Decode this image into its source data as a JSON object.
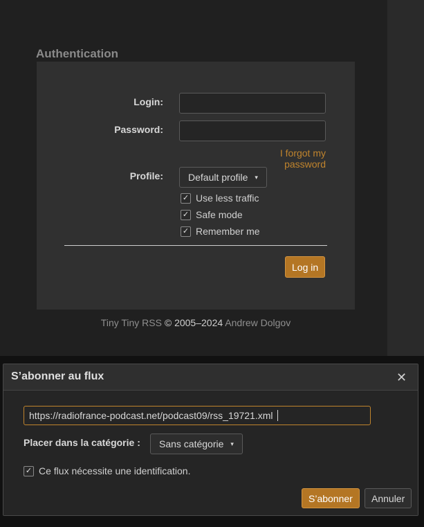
{
  "auth": {
    "title": "Authentication",
    "login_label": "Login:",
    "password_label": "Password:",
    "forgot_link": "I forgot my password",
    "profile_label": "Profile:",
    "profile_value": "Default profile",
    "checkboxes": [
      {
        "label": "Use less traffic",
        "checked": true
      },
      {
        "label": "Safe mode",
        "checked": true
      },
      {
        "label": "Remember me",
        "checked": true
      }
    ],
    "login_button": "Log in"
  },
  "footer": {
    "app_name": "Tiny Tiny RSS",
    "copyright": "© 2005–2024",
    "author": "Andrew Dolgov"
  },
  "dialog": {
    "title": "S’abonner au flux",
    "close_glyph": "✕",
    "url_value": "https://radiofrance-podcast.net/podcast09/rss_19721.xml",
    "category_label": "Placer dans la catégorie :",
    "category_value": "Sans catégorie",
    "auth_checkbox_label": "Ce flux nécessite une identification.",
    "subscribe_button": "S’abonner",
    "cancel_button": "Annuler"
  },
  "colors": {
    "accent": "#b47624",
    "link": "#c0842d",
    "panel": "#303030",
    "background": "#202020"
  },
  "icons": {
    "checkmark": "✓",
    "caret": "▾"
  }
}
